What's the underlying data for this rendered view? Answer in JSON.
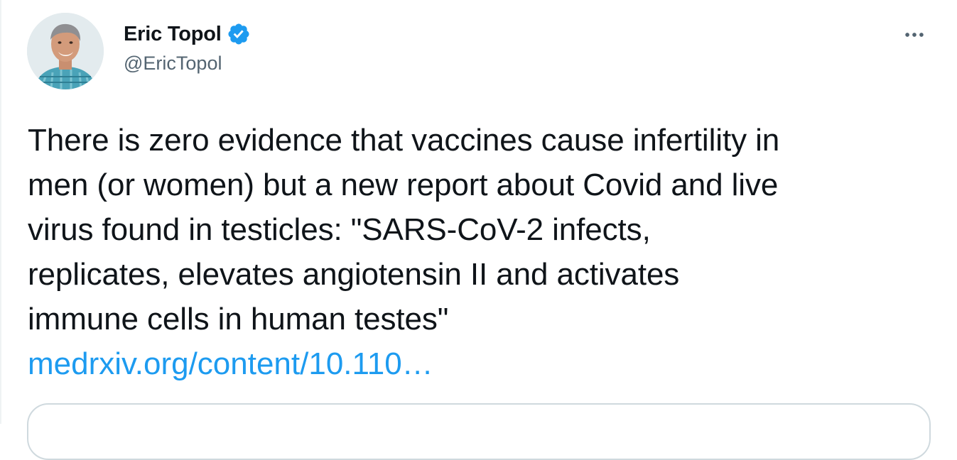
{
  "tweet": {
    "author": {
      "display_name": "Eric Topol",
      "handle": "@EricTopol",
      "verified": true,
      "verified_icon": "verified-badge-icon",
      "avatar_icon": "profile-photo"
    },
    "more_icon": "more-horizontal-icon",
    "text": "There is zero evidence that vaccines cause infertility in\nmen (or women) but a new report about Covid and live\nvirus found in testicles: \"SARS-CoV-2 infects,\nreplicates, elevates angiotensin II and activates\nimmune cells in human testes\"",
    "link": "medrxiv.org/content/10.110…"
  },
  "colors": {
    "text": "#0f1419",
    "secondary_text": "#536471",
    "link": "#1d9bf0",
    "verified_badge": "#1d9bf0",
    "border": "#cfd9de"
  }
}
